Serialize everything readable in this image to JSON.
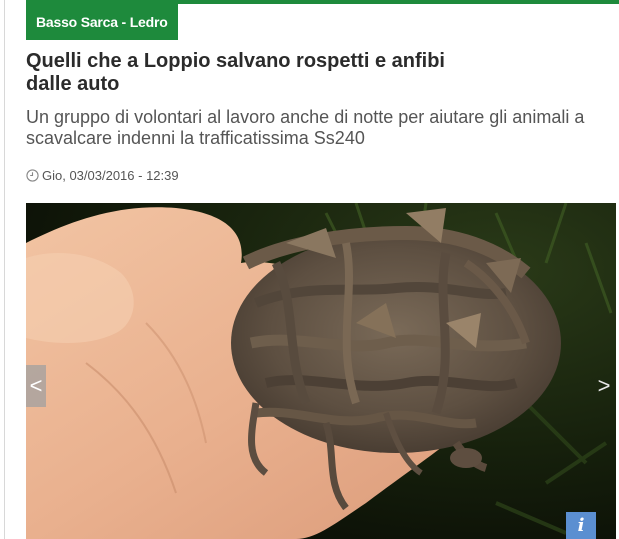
{
  "article": {
    "category": "Basso Sarca - Ledro",
    "headline": "Quelli che a Loppio salvano rospetti e anfibi dalle auto",
    "subheadline": "Un gruppo di volontari al lavoro anche di notte per aiutare gli animali a scavalcare indenni la trafficatissima Ss240",
    "date": "Gio, 03/03/2016 - 12:39"
  },
  "gallery": {
    "prev_label": "<",
    "next_label": ">",
    "info_label": "i"
  },
  "colors": {
    "brand_green": "#1e8a3c",
    "info_blue": "#5b8fd1"
  },
  "icons": {
    "date": "clock-icon",
    "info": "info-icon"
  }
}
